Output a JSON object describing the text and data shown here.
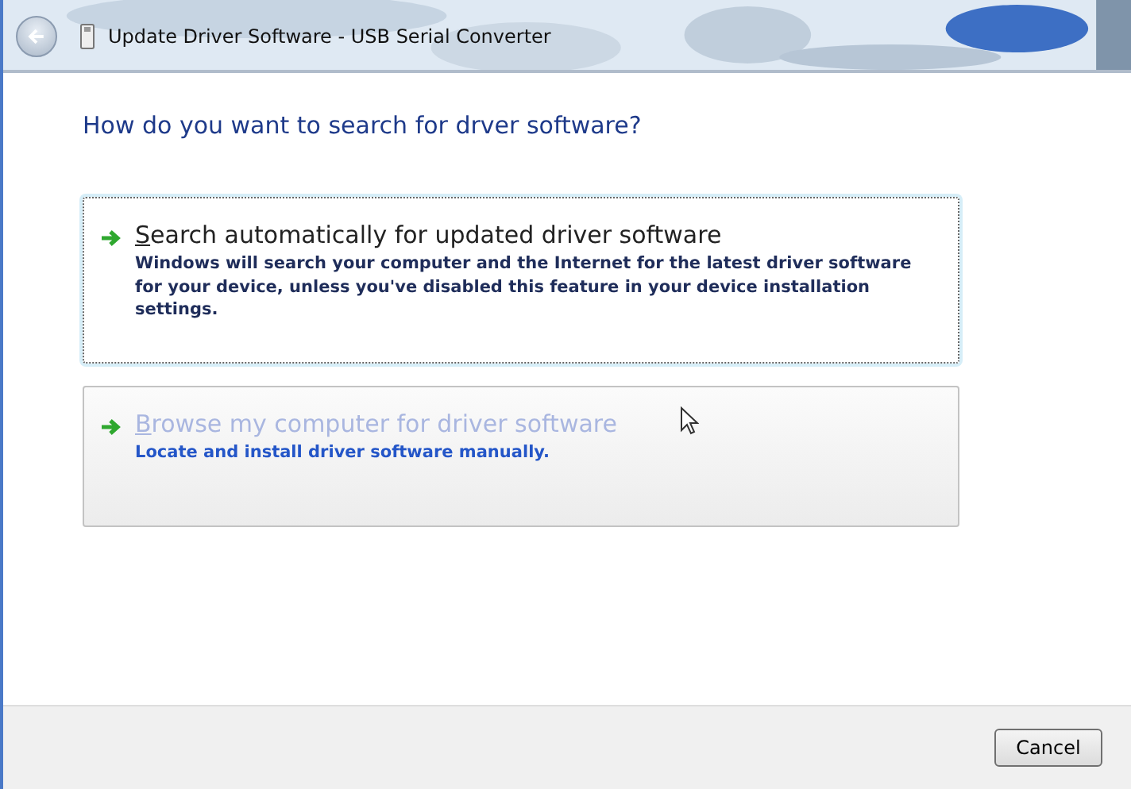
{
  "window": {
    "title": "Update Driver Software - USB Serial Converter"
  },
  "heading": "How do you want to search for drver software?",
  "options": [
    {
      "title_key": "S",
      "title_rest": "earch automatically for updated driver software",
      "description": "Windows will search your computer and the Internet for the latest driver software for your device, unless you've disabled this feature in your device installation settings.",
      "focused": true,
      "hovered": false
    },
    {
      "title_key": "B",
      "title_rest": "rowse my computer for driver software",
      "description": "Locate and install driver software manually.",
      "focused": false,
      "hovered": true
    }
  ],
  "buttons": [
    {
      "label": "Cancel"
    }
  ]
}
